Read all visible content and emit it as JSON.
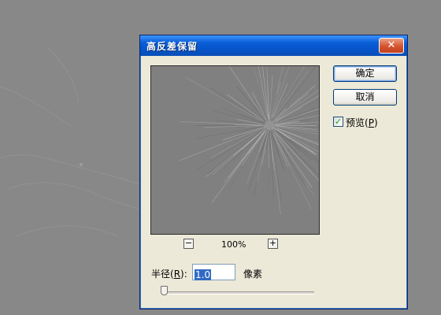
{
  "dialog": {
    "title": "高反差保留",
    "close_label": "✕",
    "zoom": {
      "minus_label": "−",
      "plus_label": "+",
      "level": "100%"
    },
    "buttons": {
      "ok_label": "确定",
      "cancel_label": "取消"
    },
    "preview": {
      "label_prefix": "预览(",
      "mnemonic": "P",
      "label_suffix": ")",
      "checked": true
    },
    "radius": {
      "label_prefix": "半径(",
      "mnemonic": "R",
      "label_suffix": "):",
      "value": "1.0",
      "unit": "像素",
      "slider_level": 0.01
    }
  },
  "colors": {
    "background": "#888888",
    "dialog_body": "#ece9d8",
    "titlebar": "#0a5fd8",
    "close_button": "#d5532e",
    "selection": "#316ac5",
    "checkmark": "#21a121"
  },
  "icons": {
    "close": "close-icon",
    "zoom_out": "minus-icon",
    "zoom_in": "plus-icon",
    "check": "checkmark-icon"
  }
}
